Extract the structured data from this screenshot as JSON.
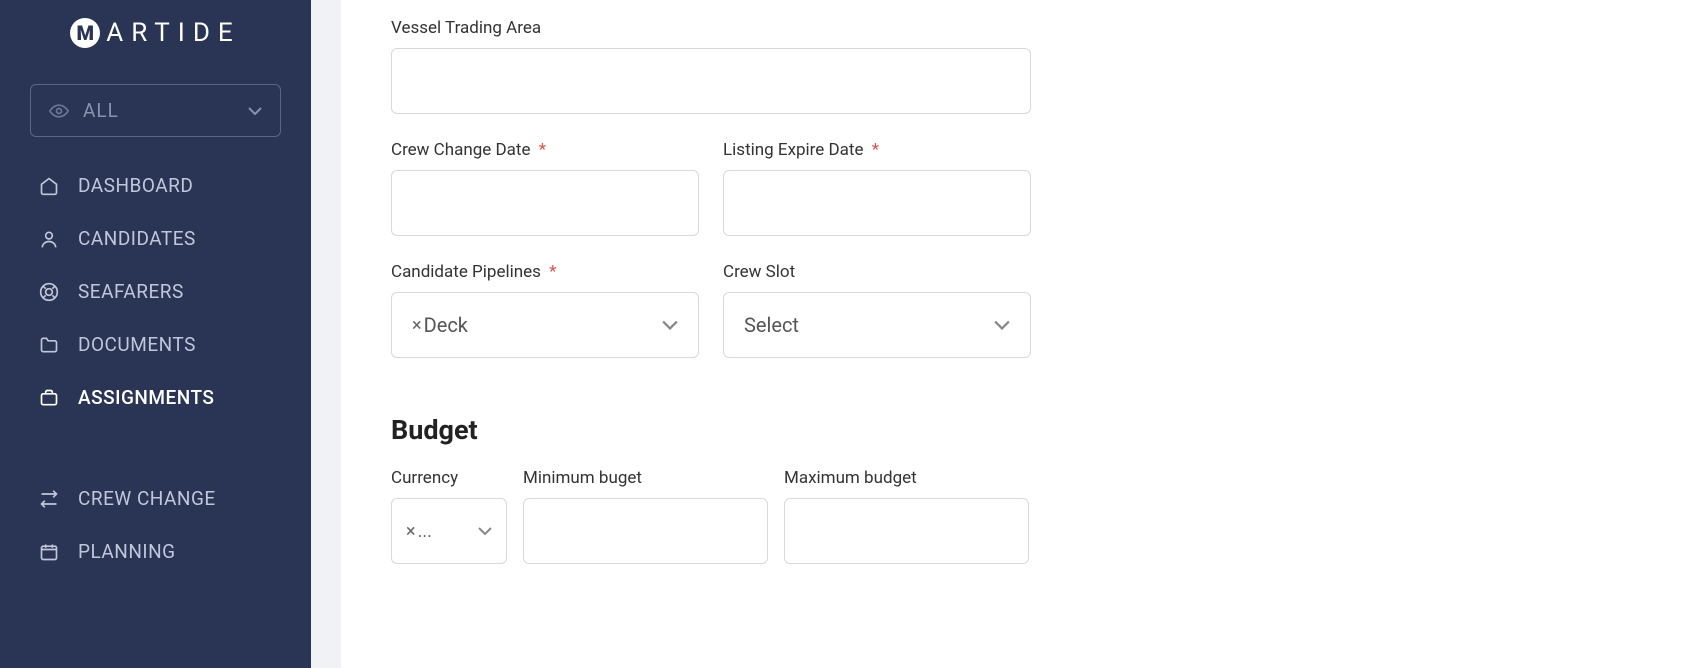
{
  "logo": {
    "text": "ARTIDE"
  },
  "filter": {
    "label": "ALL"
  },
  "nav": {
    "items": [
      {
        "label": "DASHBOARD"
      },
      {
        "label": "CANDIDATES"
      },
      {
        "label": "SEAFARERS"
      },
      {
        "label": "DOCUMENTS"
      },
      {
        "label": "ASSIGNMENTS"
      }
    ],
    "secondary": [
      {
        "label": "CREW CHANGE"
      },
      {
        "label": "PLANNING"
      }
    ]
  },
  "form": {
    "vessel_trading_area": {
      "label": "Vessel Trading Area",
      "value": ""
    },
    "crew_change_date": {
      "label": "Crew Change Date",
      "value": ""
    },
    "listing_expire_date": {
      "label": "Listing Expire Date",
      "value": ""
    },
    "candidate_pipelines": {
      "label": "Candidate Pipelines",
      "value": "Deck"
    },
    "crew_slot": {
      "label": "Crew Slot",
      "placeholder": "Select"
    },
    "budget": {
      "title": "Budget",
      "currency": {
        "label": "Currency",
        "value": "..."
      },
      "min": {
        "label": "Minimum buget",
        "value": ""
      },
      "max": {
        "label": "Maximum budget",
        "value": ""
      }
    }
  }
}
